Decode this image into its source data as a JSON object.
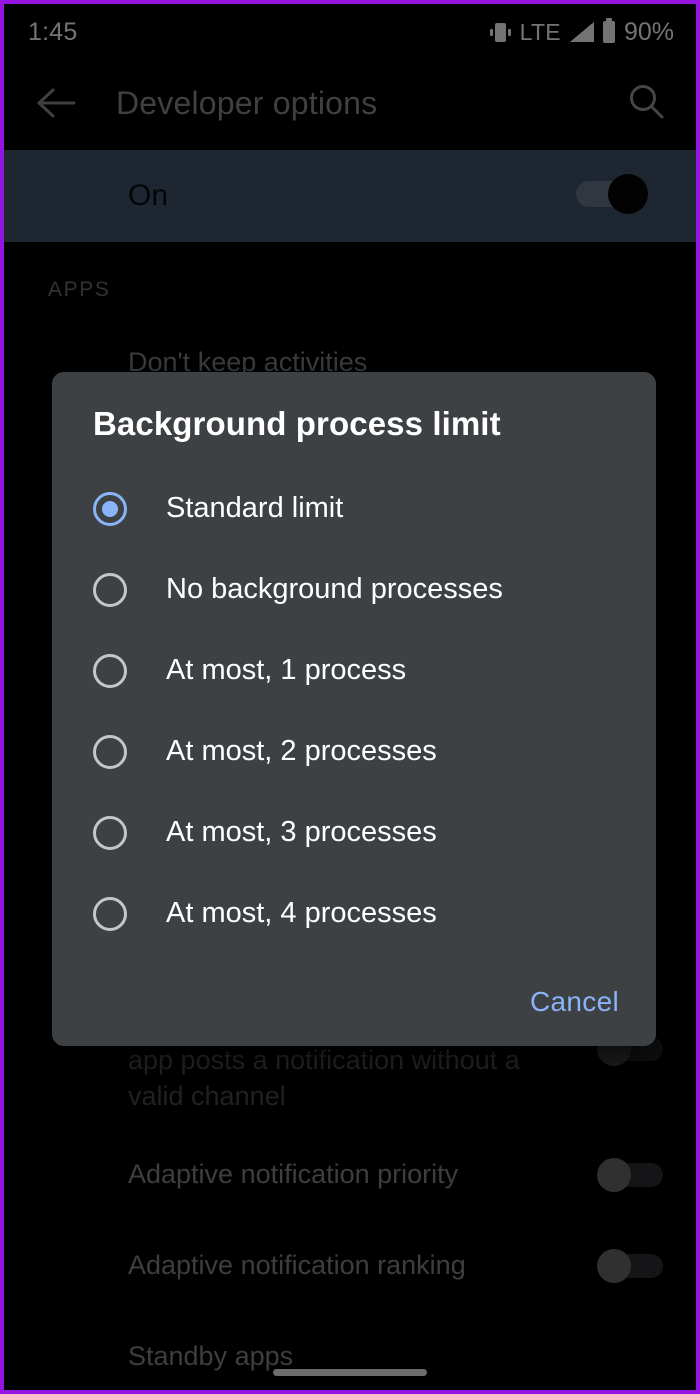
{
  "status_bar": {
    "time": "1:45",
    "vibrate_icon": "vibrate-icon",
    "network_type": "LTE",
    "signal_icon": "signal-icon",
    "battery_icon": "battery-icon",
    "battery_percent": "90%"
  },
  "app_bar": {
    "back_icon": "back-arrow-icon",
    "title": "Developer options",
    "search_icon": "search-icon"
  },
  "master_switch": {
    "label": "On",
    "state": "on"
  },
  "settings_list": {
    "section_header": "APPS",
    "rows": [
      {
        "label": "Don't keep activities"
      },
      {
        "label": "app posts a notification without a valid channel"
      },
      {
        "label": "Adaptive notification priority",
        "toggle": "off"
      },
      {
        "label": "Adaptive notification ranking",
        "toggle": "off"
      },
      {
        "label": "Standby apps"
      }
    ]
  },
  "dialog": {
    "title": "Background process limit",
    "options": [
      {
        "label": "Standard limit",
        "selected": true
      },
      {
        "label": "No background processes",
        "selected": false
      },
      {
        "label": "At most, 1 process",
        "selected": false
      },
      {
        "label": "At most, 2 processes",
        "selected": false
      },
      {
        "label": "At most, 3 processes",
        "selected": false
      },
      {
        "label": "At most, 4 processes",
        "selected": false
      }
    ],
    "cancel_label": "Cancel"
  },
  "colors": {
    "frame": "#9414e0",
    "master_bar": "#44556e",
    "dialog_bg": "#3e4144",
    "accent_blue": "#8ab4f8",
    "background": "#000000"
  }
}
